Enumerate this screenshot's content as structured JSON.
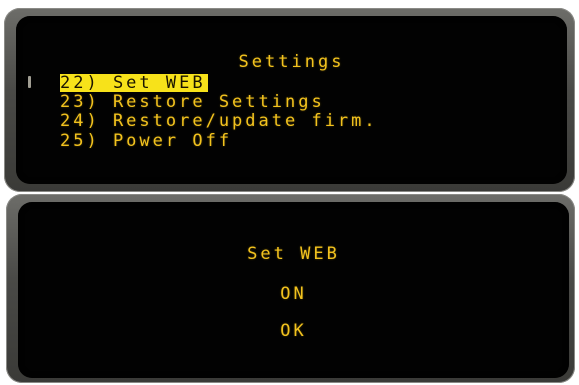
{
  "settings_menu": {
    "title": "Settings",
    "items": [
      {
        "label": "22) Set WEB",
        "selected": true
      },
      {
        "label": "23) Restore Settings",
        "selected": false
      },
      {
        "label": "24) Restore/update firm.",
        "selected": false
      },
      {
        "label": "25) Power Off",
        "selected": false
      }
    ]
  },
  "set_web_dialog": {
    "title": "Set WEB",
    "value": "ON",
    "confirm_label": "OK"
  },
  "colors": {
    "lcd_text": "#f2c21e",
    "highlight_bg": "#f7e21a",
    "screen_bg": "#020202",
    "bezel": "#4a4a47"
  }
}
